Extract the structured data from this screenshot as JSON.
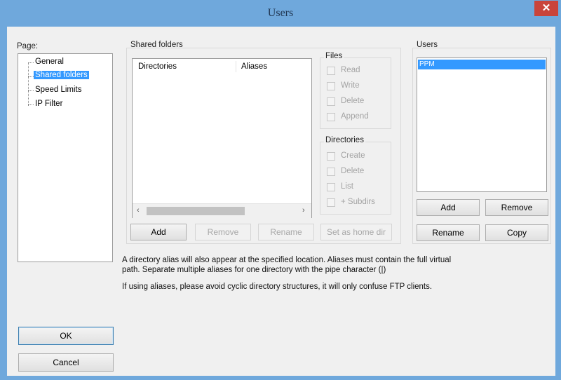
{
  "window": {
    "title": "Users",
    "close_glyph": "✕"
  },
  "page_panel": {
    "label": "Page:",
    "items": [
      {
        "label": "General",
        "selected": false
      },
      {
        "label": "Shared folders",
        "selected": true
      },
      {
        "label": "Speed Limits",
        "selected": false
      },
      {
        "label": "IP Filter",
        "selected": false
      }
    ]
  },
  "shared_folders": {
    "label": "Shared folders",
    "columns": [
      "Directories",
      "Aliases"
    ],
    "scroll_left": "‹",
    "scroll_right": "›",
    "buttons": {
      "add": "Add",
      "remove": "Remove",
      "rename": "Rename",
      "set_home": "Set as home dir"
    }
  },
  "files_group": {
    "title": "Files",
    "options": [
      "Read",
      "Write",
      "Delete",
      "Append"
    ]
  },
  "directories_group": {
    "title": "Directories",
    "options": [
      "Create",
      "Delete",
      "List",
      "+ Subdirs"
    ]
  },
  "users_panel": {
    "label": "Users",
    "list": [
      "PPM"
    ],
    "buttons": {
      "add": "Add",
      "remove": "Remove",
      "rename": "Rename",
      "copy": "Copy"
    }
  },
  "info": {
    "line1": "A directory alias will also appear at the specified location. Aliases must contain the full virtual",
    "line2": "path. Separate multiple aliases for one directory with the pipe character (|)",
    "line3": "If using aliases, please avoid cyclic directory structures, it will only confuse FTP clients."
  },
  "dialog_buttons": {
    "ok": "OK",
    "cancel": "Cancel"
  },
  "colors": {
    "titlebar": "#6fa8dc",
    "selection": "#3399ff",
    "close": "#c9443b"
  }
}
